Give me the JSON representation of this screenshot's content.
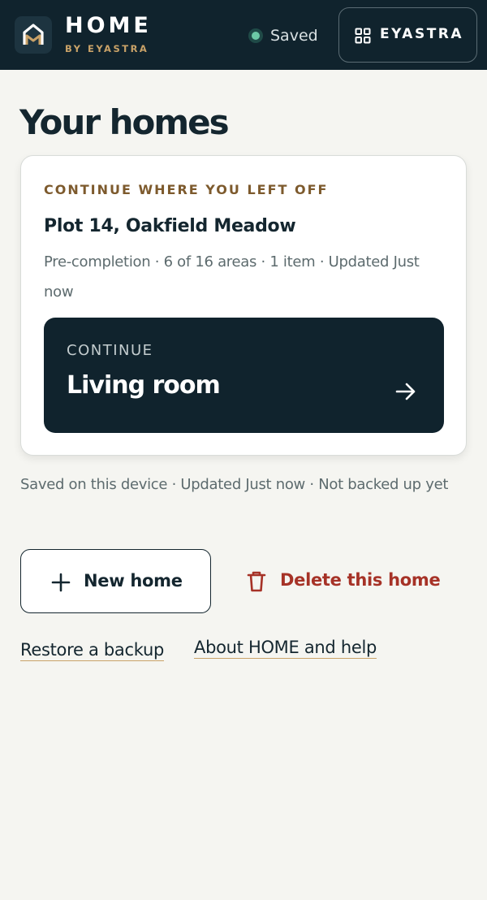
{
  "header": {
    "brand_title": "HOME",
    "brand_subtitle": "BY EYASTRA",
    "save_status": "Saved",
    "menu_button_label": "EYASTRA"
  },
  "page": {
    "title": "Your homes"
  },
  "resume_card": {
    "eyebrow": "CONTINUE WHERE YOU LEFT OFF",
    "home_name": "Plot 14, Oakfield Meadow",
    "meta": "Pre-completion · 6 of 16 areas · 1 item · Updated Just now",
    "continue_eyebrow": "CONTINUE",
    "continue_room": "Living room"
  },
  "status_line": "Saved on this device · Updated Just now · Not backed up yet",
  "actions": {
    "new_home_label": "New home",
    "delete_label": "Delete this home"
  },
  "links": {
    "restore": "Restore a backup",
    "about": "About HOME and help"
  },
  "colors": {
    "header_bg": "#10232d",
    "accent_gold": "#c9a268",
    "saved_green": "#6ccaa6",
    "danger_red": "#a63227",
    "page_bg": "#f5f5f1"
  },
  "icons": {
    "logo": "home-logo-icon",
    "menu": "grid-icon",
    "continue": "arrow-right-icon",
    "new_home": "plus-icon",
    "delete": "trash-icon"
  }
}
